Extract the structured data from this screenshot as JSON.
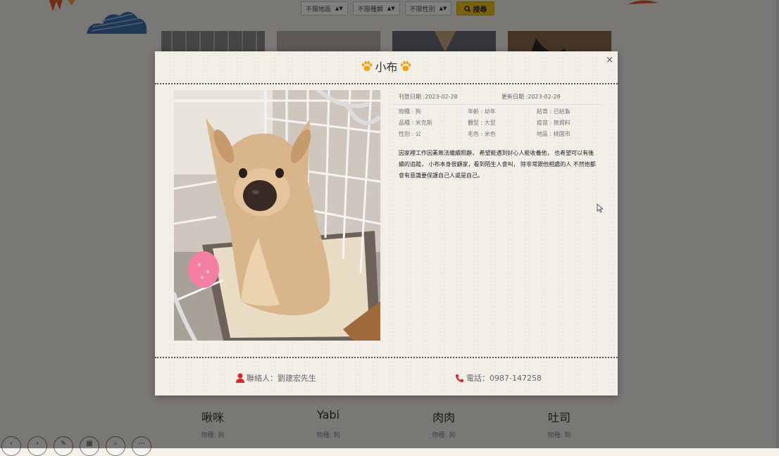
{
  "filters": {
    "region": "不限地區",
    "kind": "不限種類",
    "sex": "不限性別",
    "search_label": "搜尋"
  },
  "background_cards": [
    {
      "name": "啾咪",
      "meta": "物種: 狗"
    },
    {
      "name": "Yabi",
      "meta": "物種: 狗"
    },
    {
      "name": "肉肉",
      "meta": "物種: 狗"
    },
    {
      "name": "吐司",
      "meta": "物種: 狗"
    }
  ],
  "modal": {
    "title": "小布",
    "close": "×",
    "publish_date": "刊登日期 :2023-02-28",
    "update_date": "更新日期 :2023-02-28",
    "details": [
      "物種 : 狗",
      "年齡 : 幼年",
      "結育 : 已結紮",
      "品種 : 米克斯",
      "體型 : 大型",
      "疫苗 : 無資料",
      "性別 : 公",
      "毛色 : 米色",
      "地區 : 桃園市"
    ],
    "description": "因家裡工作因素無法繼續照顧， 希望能遇到好心人能收養他， 也希望可以有後續的追蹤， 小布本身很顧家，看到陌生人會叫， 除非常跟他相處的人 不然他都會有意識要保護自己人或是自己。",
    "contact": "聯絡人：劉建宏先生",
    "phone": "電話：0987-147258"
  },
  "icons": [
    "paw-icon",
    "close-icon",
    "user-icon",
    "phone-icon",
    "search-icon"
  ],
  "colors": {
    "accent_orange": "#f0a30a",
    "contact_red": "#d9262c",
    "search_yellow": "#f0c419"
  }
}
